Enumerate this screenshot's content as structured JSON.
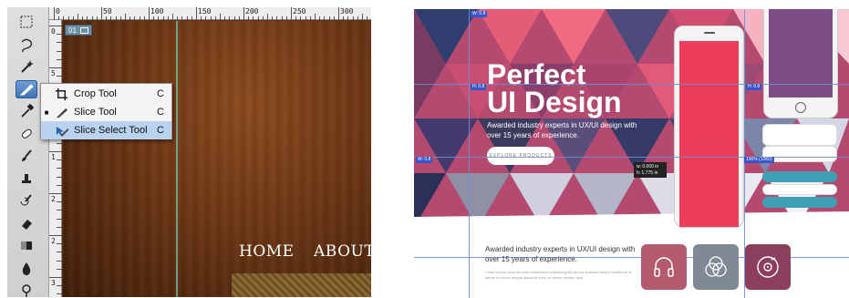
{
  "photoshop": {
    "ruler_top_labels": [
      "0",
      "50",
      "100",
      "150",
      "200",
      "250",
      "300"
    ],
    "ruler_left_labels": [
      "0",
      "5",
      "1",
      "1",
      "2",
      "2",
      "3"
    ],
    "slice_badge": "01",
    "flyout": {
      "items": [
        {
          "label": "Crop Tool",
          "shortcut": "C",
          "icon": "crop-icon",
          "bullet": ""
        },
        {
          "label": "Slice Tool",
          "shortcut": "C",
          "icon": "slice-knife-icon",
          "bullet": "■"
        },
        {
          "label": "Slice Select Tool",
          "shortcut": "C",
          "icon": "slice-select-icon",
          "bullet": ""
        }
      ],
      "active_index": 2
    },
    "nav": {
      "home": "HOME",
      "about": "ABOUT"
    },
    "tools": [
      "marquee-icon",
      "lasso-icon",
      "magic-wand-icon",
      "slice-tool-icon",
      "eyedropper-icon",
      "healing-brush-icon",
      "brush-icon",
      "clone-stamp-icon",
      "history-brush-icon",
      "eraser-icon",
      "gradient-icon",
      "blur-icon",
      "dodge-icon"
    ],
    "colors": {
      "wood": "#6b3614",
      "toolbar": "#d6d6d6",
      "selection": "#b9d3ee"
    }
  },
  "mockup": {
    "hero": {
      "title_line1": "Perfect",
      "title_line2": "UI Design",
      "subtitle": "Awarded industry experts in UX/UI design with over 15 years of experience.",
      "button": "EXPLORE PRODUCTS",
      "measure_line1": "w: 0.000 in",
      "measure_line2": "h: 1.775 in"
    },
    "guide_badges": [
      "W: 0.8",
      "H: 0.8",
      "W: 0.8",
      "H: 0.8"
    ],
    "guide_badge_wide": "100% (1060)",
    "lower": {
      "title": "Awarded industry experts in UX/UI design with over 15 years of experience.",
      "body": "Lorem ipsum dolor sit amet consectetur adipiscing elit sed do eiusmod tempor incididunt ut labore et dolore magna aliqua ut enim ad minim veniam quis."
    },
    "features": [
      {
        "icon": "headphones-icon",
        "color": "#b45a6e"
      },
      {
        "icon": "overlapping-circles-icon",
        "color": "#7f8a95"
      },
      {
        "icon": "vinyl-disc-icon",
        "color": "#8b3f5c"
      }
    ],
    "colors": {
      "hero": "#b44a6f",
      "phone_screen_red": "#ec3e5a",
      "phone_screen_purple": "#7b4c86",
      "teal": "#3f9fb4",
      "guide": "#6a8fd8"
    }
  }
}
